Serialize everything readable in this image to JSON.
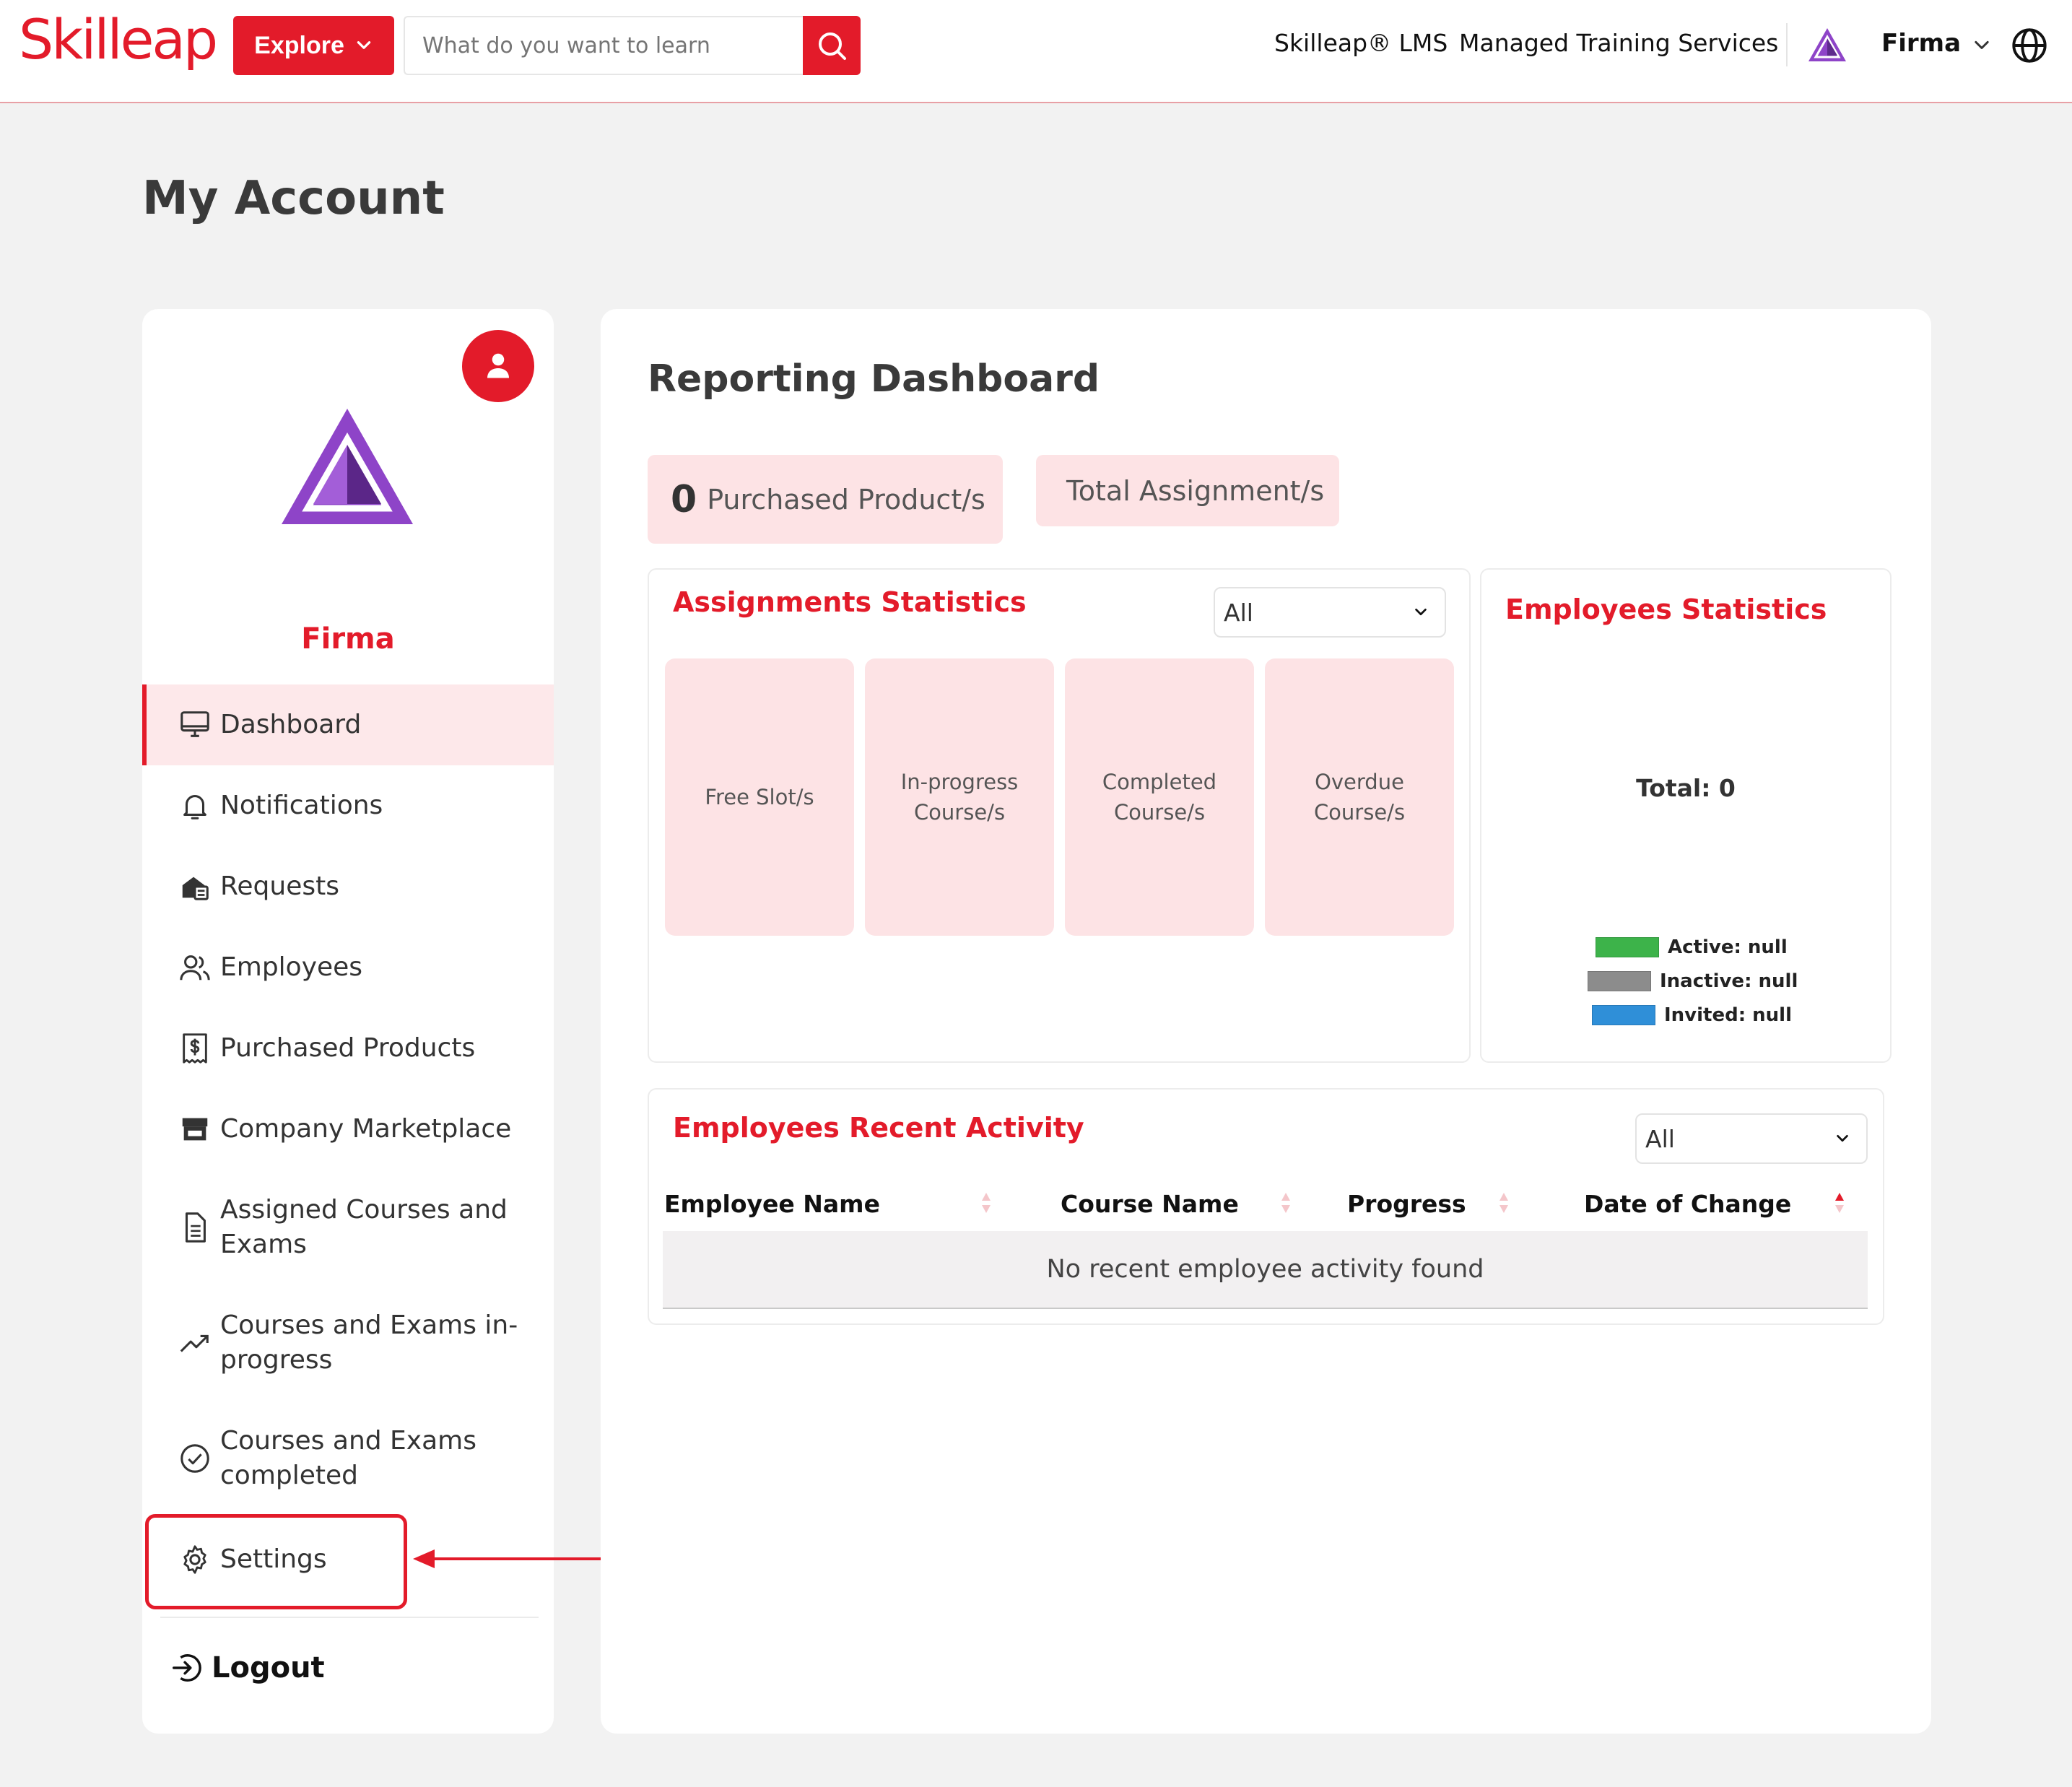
{
  "header": {
    "logo_text": "Skilleap",
    "explore_label": "Explore",
    "search_placeholder": "What do you want to learn",
    "nav_lms": "Skilleap® LMS",
    "nav_managed_training": "Managed Training Services",
    "user_name": "Firma",
    "accent_color": "#e31b2a"
  },
  "page": {
    "title": "My Account"
  },
  "sidebar": {
    "company_name": "Firma",
    "items": [
      {
        "label": "Dashboard",
        "icon": "monitor-icon",
        "active": true
      },
      {
        "label": "Notifications",
        "icon": "bell-icon"
      },
      {
        "label": "Requests",
        "icon": "requests-icon"
      },
      {
        "label": "Employees",
        "icon": "users-icon"
      },
      {
        "label": "Purchased Products",
        "icon": "invoice-dollar-icon"
      },
      {
        "label": "Company Marketplace",
        "icon": "store-icon"
      },
      {
        "label": "Assigned Courses and Exams",
        "icon": "document-icon"
      },
      {
        "label": "Courses and Exams in-progress",
        "icon": "trending-up-icon"
      },
      {
        "label": "Courses and Exams completed",
        "icon": "check-circle-icon"
      },
      {
        "label": "Settings",
        "icon": "gear-icon",
        "highlighted": true
      }
    ],
    "logout_label": "Logout"
  },
  "dashboard": {
    "title": "Reporting Dashboard",
    "purchased_count": "0",
    "purchased_label": "Purchased Product/s",
    "total_assignments_label": "Total Assignment/s",
    "assignments": {
      "title": "Assignments Statistics",
      "filter_value": "All",
      "tiles": [
        "Free Slot/s",
        "In-progress Course/s",
        "Completed Course/s",
        "Overdue Course/s"
      ]
    },
    "employees": {
      "title": "Employees Statistics",
      "total": "Total: 0",
      "legend": [
        {
          "label": "Active: null",
          "color": "#3db34a"
        },
        {
          "label": "Inactive: null",
          "color": "#8c8c8c"
        },
        {
          "label": "Invited: null",
          "color": "#2f8fd8"
        }
      ]
    },
    "activity": {
      "title": "Employees Recent Activity",
      "filter_value": "All",
      "columns": [
        "Employee Name",
        "Course Name",
        "Progress",
        "Date of Change"
      ],
      "empty_message": "No recent employee activity found"
    }
  }
}
